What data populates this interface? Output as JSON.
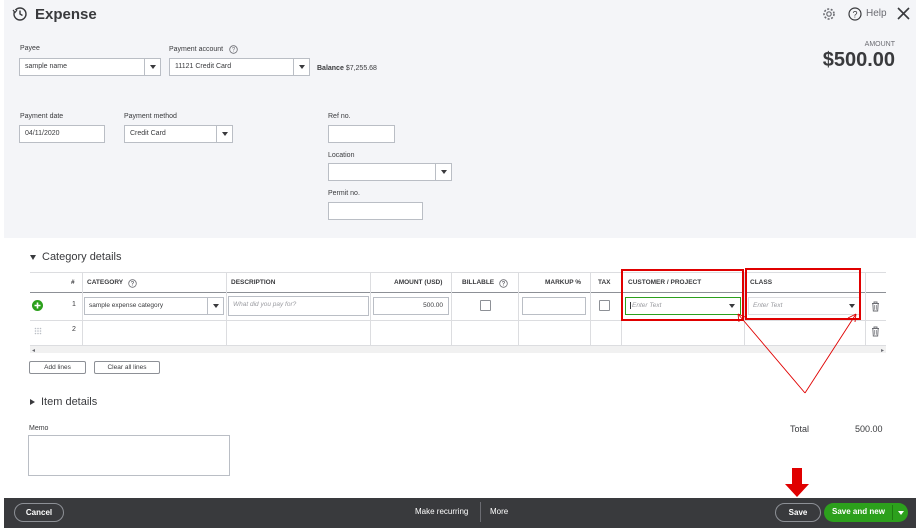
{
  "header": {
    "title": "Expense",
    "help_label": "Help"
  },
  "form": {
    "payee_label": "Payee",
    "payee_value": "sample name",
    "payment_account_label": "Payment account",
    "payment_account_value": "11121 Credit Card",
    "balance_label": "Balance",
    "balance_value": "$7,255.68",
    "amount_label": "AMOUNT",
    "amount_value": "$500.00",
    "payment_date_label": "Payment date",
    "payment_date_value": "04/11/2020",
    "payment_method_label": "Payment method",
    "payment_method_value": "Credit Card",
    "ref_no_label": "Ref no.",
    "location_label": "Location",
    "permit_no_label": "Permit no."
  },
  "category_details": {
    "title": "Category details",
    "columns": [
      "#",
      "CATEGORY",
      "DESCRIPTION",
      "AMOUNT (USD)",
      "BILLABLE",
      "MARKUP %",
      "TAX",
      "CUSTOMER / PROJECT",
      "CLASS"
    ],
    "rows": [
      {
        "num": "1",
        "category": "sample expense category",
        "description_placeholder": "What did you pay for?",
        "amount": "500.00",
        "customer_placeholder": "Enter Text",
        "class_placeholder": "Enter Text"
      },
      {
        "num": "2"
      }
    ],
    "add_lines_label": "Add lines",
    "clear_lines_label": "Clear all lines"
  },
  "item_details": {
    "title": "Item details"
  },
  "memo_label": "Memo",
  "total_label": "Total",
  "total_value": "500.00",
  "footer": {
    "cancel_label": "Cancel",
    "make_recurring_label": "Make recurring",
    "more_label": "More",
    "save_label": "Save",
    "save_and_new_label": "Save and new"
  },
  "colors": {
    "brand_green": "#2ca01c",
    "annotation_red": "#e00000",
    "footer_bg": "#393a3d"
  }
}
